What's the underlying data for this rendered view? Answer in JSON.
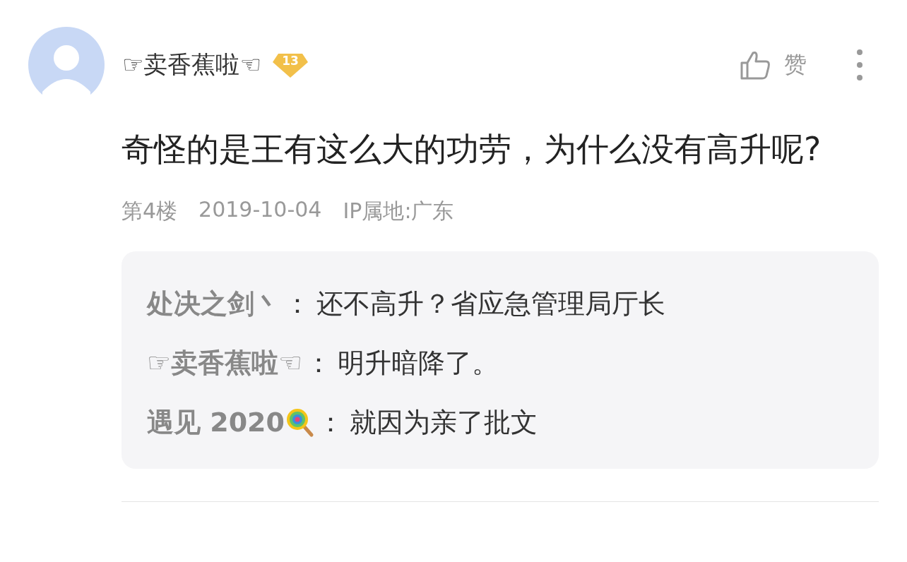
{
  "comment": {
    "author": "☞卖香蕉啦☜",
    "level_badge": "13",
    "like_label": "赞",
    "text": "奇怪的是王有这么大的功劳，为什么没有高升呢?",
    "floor": "第4楼",
    "date": "2019-10-04",
    "ip_location": "IP属地:广东"
  },
  "replies": [
    {
      "author": "处决之剑丶",
      "separator": "：",
      "text": "还不高升？省应急管理局厅长",
      "author_icon": false
    },
    {
      "author": "☞卖香蕉啦☜",
      "separator": "：",
      "text": "明升暗降了。",
      "author_icon": false
    },
    {
      "author": "遇见 2020",
      "separator": "：",
      "text": "就因为亲了批文",
      "author_icon": true
    }
  ]
}
